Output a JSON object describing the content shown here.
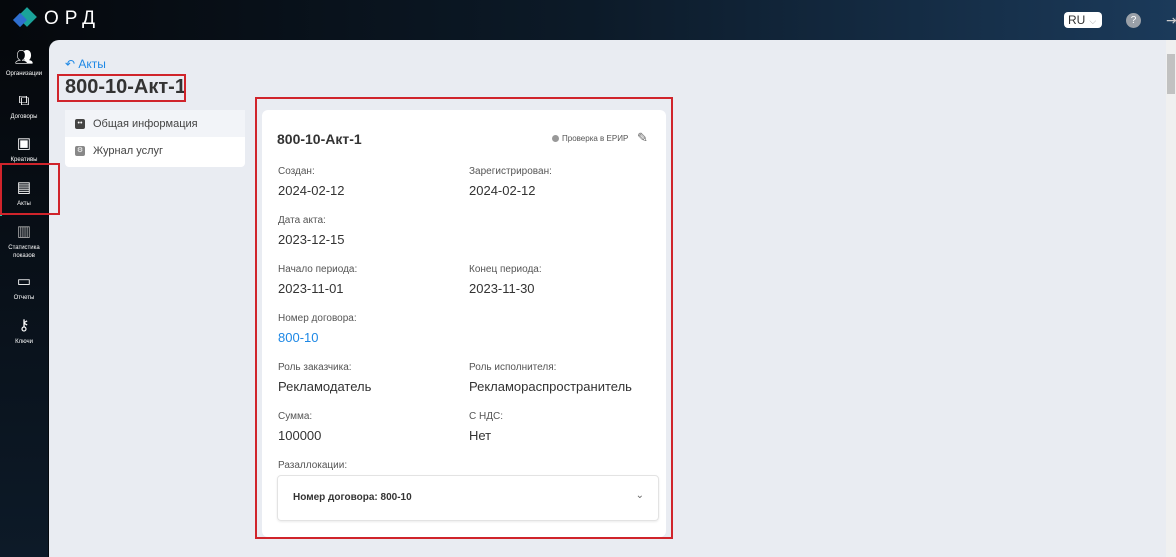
{
  "header": {
    "logo": "ОРД",
    "language": "RU",
    "help": "?"
  },
  "sidebar": {
    "items": [
      {
        "label": "Организации",
        "icon": "users-icon"
      },
      {
        "label": "Договоры",
        "icon": "copy-icon"
      },
      {
        "label": "Креативы",
        "icon": "image-icon"
      },
      {
        "label": "Акты",
        "icon": "document-icon"
      },
      {
        "label": "Статистика показов",
        "icon": "stats-icon"
      },
      {
        "label": "Отчеты",
        "icon": "report-icon"
      },
      {
        "label": "Ключи",
        "icon": "key-icon"
      }
    ]
  },
  "breadcrumb": {
    "back": "Акты"
  },
  "page_title": "800-10-Акт-1",
  "tabs": [
    {
      "label": "Общая информация"
    },
    {
      "label": "Журнал услуг"
    }
  ],
  "card": {
    "title": "800-10-Акт-1",
    "erir": "Проверка в ЕРИР",
    "fields": [
      {
        "label": "Создан:",
        "value": "2024-02-12"
      },
      {
        "label": "Зарегистрирован:",
        "value": "2024-02-12"
      },
      {
        "label": "Дата акта:",
        "value": "2023-12-15"
      },
      {
        "label": "Начало периода:",
        "value": "2023-11-01"
      },
      {
        "label": "Конец периода:",
        "value": "2023-11-30"
      },
      {
        "label": "Номер договора:",
        "value": "800-10"
      },
      {
        "label": "Роль заказчика:",
        "value": "Рекламодатель"
      },
      {
        "label": "Роль исполнителя:",
        "value": "Рекламораспространитель"
      },
      {
        "label": "Сумма:",
        "value": "100000"
      },
      {
        "label": "С НДС:",
        "value": "Нет"
      }
    ],
    "reallocations_label": "Разаллокации:",
    "accordion_title": "Номер договора: 800-10"
  }
}
